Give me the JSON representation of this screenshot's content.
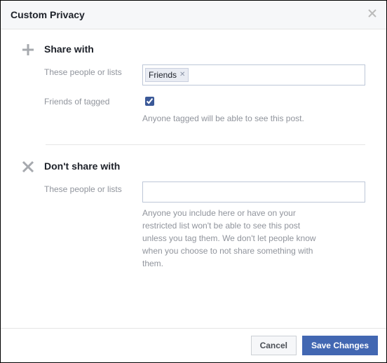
{
  "header": {
    "title": "Custom Privacy"
  },
  "share": {
    "heading": "Share with",
    "people_label": "These people or lists",
    "token": "Friends",
    "friends_tagged_label": "Friends of tagged",
    "friends_tagged_checked": true,
    "note": "Anyone tagged will be able to see this post."
  },
  "dont_share": {
    "heading": "Don't share with",
    "people_label": "These people or lists",
    "note": "Anyone you include here or have on your restricted list won't be able to see this post unless you tag them. We don't let people know when you choose to not share something with them."
  },
  "footer": {
    "cancel": "Cancel",
    "save": "Save Changes"
  }
}
